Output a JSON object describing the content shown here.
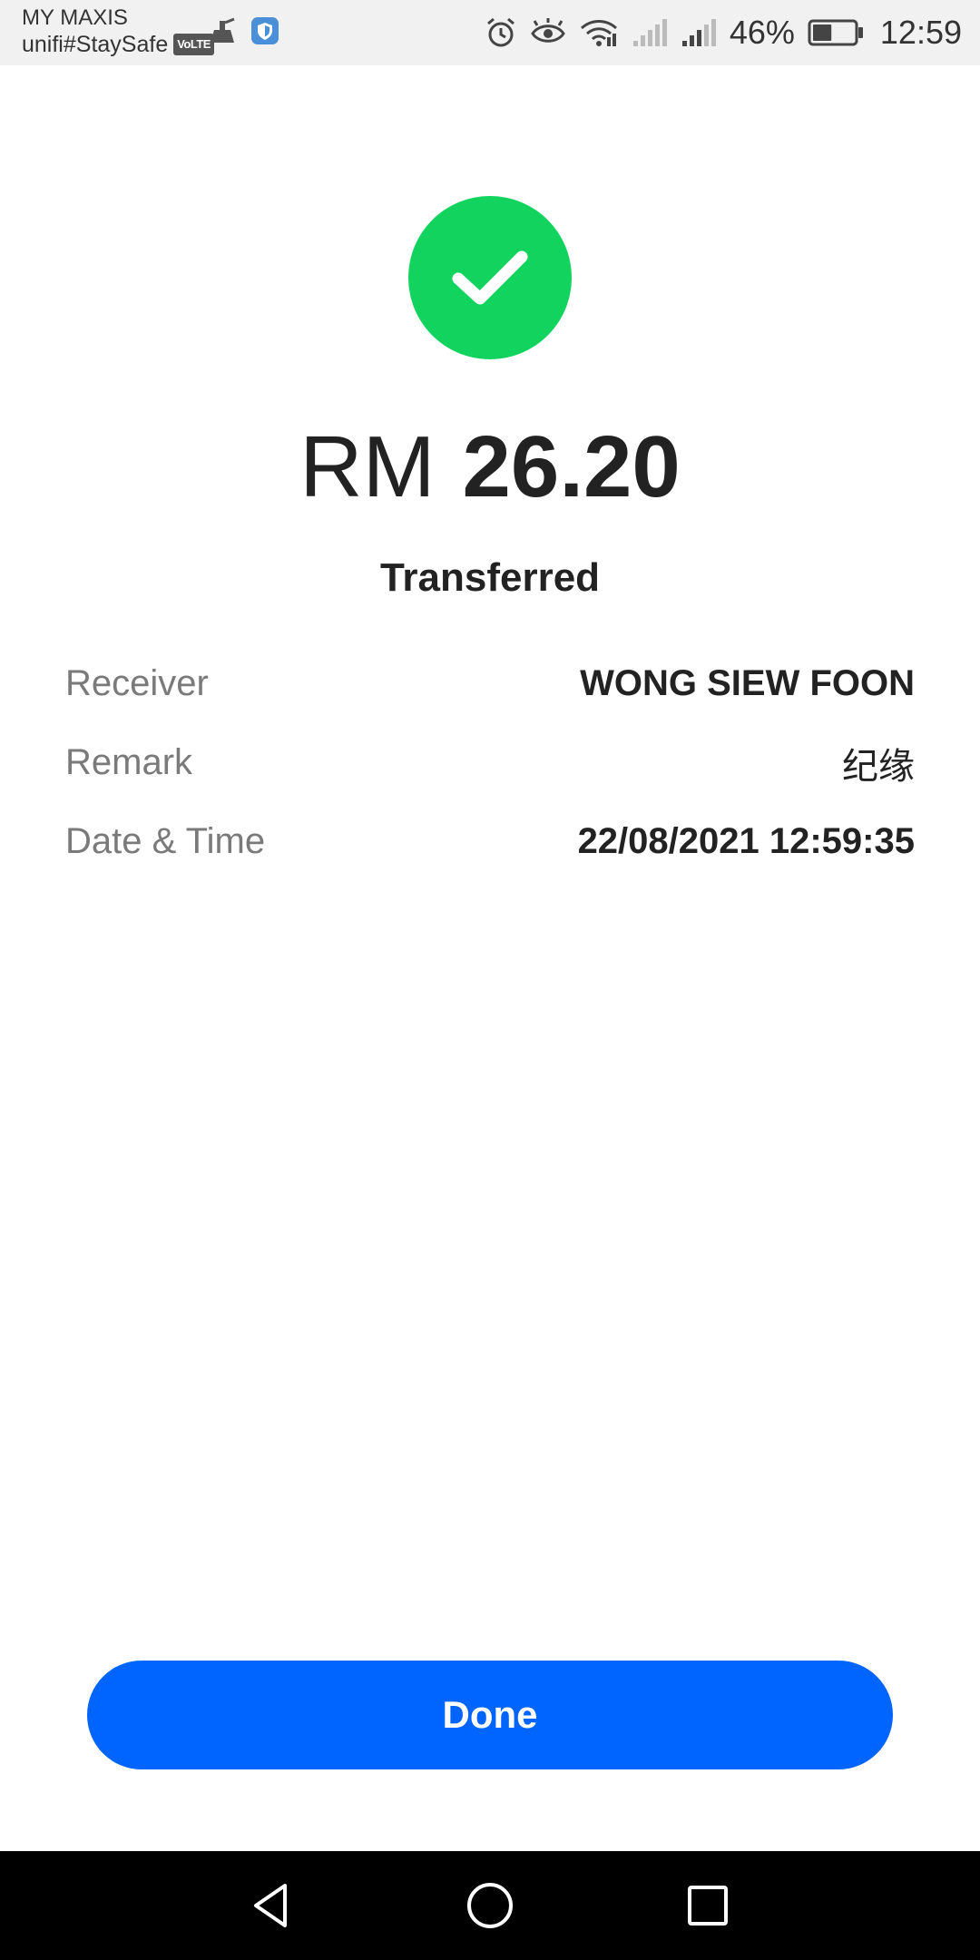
{
  "status_bar": {
    "carrier": "MY MAXIS",
    "network": "unifi#StaySafe",
    "volte": "VoLTE",
    "battery_percent": "46%",
    "time": "12:59",
    "icons": [
      "cleaner-icon",
      "shield-icon",
      "alarm-icon",
      "eye-comfort-icon",
      "wifi-icon",
      "signal-icon",
      "signal-icon",
      "battery-icon"
    ],
    "battery_level": 0.46
  },
  "receipt": {
    "currency": "RM",
    "amount": "26.20",
    "status": "Transferred",
    "success_icon": "checkmark-icon",
    "success_color": "#12d35d",
    "details": [
      {
        "label": "Receiver",
        "value": "WONG SIEW FOON"
      },
      {
        "label": "Remark",
        "value": "纪缘"
      },
      {
        "label": "Date & Time",
        "value": "22/08/2021 12:59:35"
      }
    ]
  },
  "actions": {
    "done_label": "Done",
    "accent_color": "#0064ff"
  },
  "nav_bar": {
    "icons": [
      "back-icon",
      "home-icon",
      "recents-icon"
    ]
  }
}
